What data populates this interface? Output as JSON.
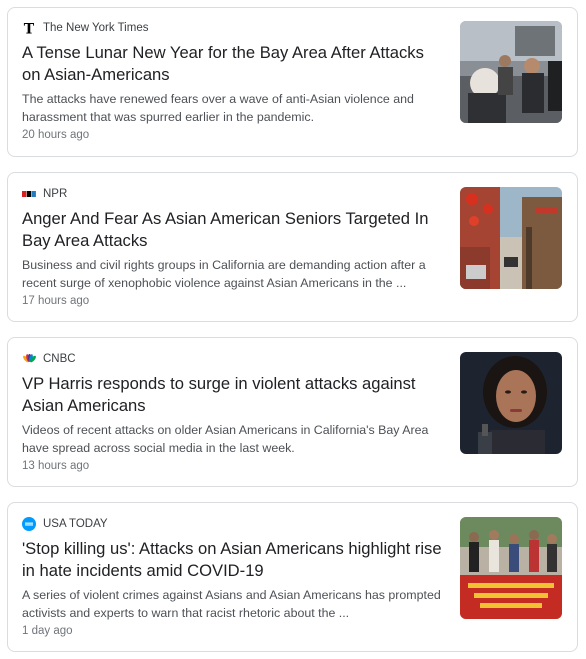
{
  "cards": [
    {
      "source": "The New York Times",
      "source_icon": "nyt-logo-icon",
      "headline": "A Tense Lunar New Year for the Bay Area After Attacks on Asian-Americans",
      "snippet": "The attacks have renewed fears over a wave of anti-Asian violence and harassment that was spurred earlier in the pandemic.",
      "time": "20 hours ago",
      "thumb_icon": "street-crowd-photo"
    },
    {
      "source": "NPR",
      "source_icon": "npr-logo-icon",
      "headline": "Anger And Fear As Asian American Seniors Targeted In Bay Area Attacks",
      "snippet": "Business and civil rights groups in California are demanding action after a recent surge of xenophobic violence against Asian Americans in the ...",
      "time": "17 hours ago",
      "thumb_icon": "chinatown-street-photo"
    },
    {
      "source": "CNBC",
      "source_icon": "cnbc-peacock-icon",
      "headline": "VP Harris responds to surge in violent attacks against Asian Americans",
      "snippet": "Videos of recent attacks on older Asian Americans in California's Bay Area have spread across social media in the last week.",
      "time": "13 hours ago",
      "thumb_icon": "portrait-photo"
    },
    {
      "source": "USA TODAY",
      "source_icon": "usa-today-logo-icon",
      "headline": "'Stop killing us': Attacks on Asian Americans highlight rise in hate incidents amid COVID-19",
      "snippet": "A series of violent crimes against Asians and Asian Americans has prompted activists and experts to warn that racist rhetoric about the ...",
      "time": "1 day ago",
      "thumb_icon": "rally-crowd-photo"
    }
  ],
  "colors": {
    "card_border": "#dadce0",
    "headline": "#202124",
    "snippet": "#4d5156",
    "time": "#70757a",
    "usa_today_blue": "#009bff"
  }
}
